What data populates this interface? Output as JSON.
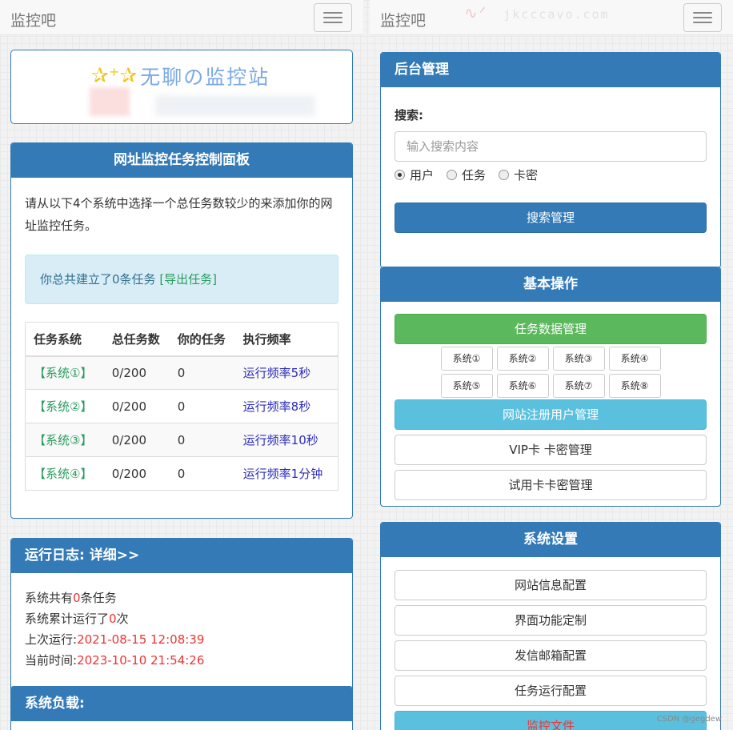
{
  "left": {
    "brand": "监控吧",
    "logo_text": "无聊の监控站",
    "task_panel": {
      "title": "网址监控任务控制面板",
      "intro": "请从以下4个系统中选择一个总任务数较少的来添加你的网址监控任务。",
      "alert_text": "你总共建立了0条任务 ",
      "alert_link": "[导出任务]",
      "columns": [
        "任务系统",
        "总任务数",
        "你的任务",
        "执行频率"
      ],
      "rows": [
        {
          "system": "【系统①】",
          "total": "0/200",
          "mine": "0",
          "freq": "运行频率5秒"
        },
        {
          "system": "【系统②】",
          "total": "0/200",
          "mine": "0",
          "freq": "运行频率8秒"
        },
        {
          "system": "【系统③】",
          "total": "0/200",
          "mine": "0",
          "freq": "运行频率10秒"
        },
        {
          "system": "【系统④】",
          "total": "0/200",
          "mine": "0",
          "freq": "运行频率1分钟"
        }
      ]
    },
    "log_panel": {
      "title": "运行日志:  详细>>",
      "line1_prefix": "系统共有",
      "line1_value": "0",
      "line1_suffix": "条任务",
      "line2_prefix": "系统累计运行了",
      "line2_value": "0",
      "line2_suffix": "次",
      "line3_prefix": "上次运行:",
      "line3_value": "2021-08-15 12:08:39",
      "line4_prefix": "当前时间:",
      "line4_value": "2023-10-10 21:54:26"
    },
    "load_panel": {
      "title": "系统负载:"
    }
  },
  "right": {
    "brand": "监控吧",
    "watermark": "jkcccavo.com",
    "admin_panel": {
      "title": "后台管理",
      "search_label": "搜索:",
      "search_placeholder": "输入搜索内容",
      "radio_options": [
        "用户",
        "任务",
        "卡密"
      ],
      "selected": "用户",
      "search_button": "搜索管理"
    },
    "basic_panel": {
      "title": "基本操作",
      "task_data_button": "任务数据管理",
      "systems": [
        "系统①",
        "系统②",
        "系统③",
        "系统④",
        "系统⑤",
        "系统⑥",
        "系统⑦",
        "系统⑧"
      ],
      "user_button": "网站注册用户管理",
      "vip_button": "VIP卡 卡密管理",
      "trial_button": "试用卡卡密管理"
    },
    "settings_panel": {
      "title": "系统设置",
      "buttons": [
        "网站信息配置",
        "界面功能定制",
        "发信邮箱配置",
        "任务运行配置"
      ],
      "file_button": "监控文件"
    }
  },
  "watermark_csdn": "CSDN @gegdew",
  "colors": {
    "primary": "#337ab7",
    "success": "#5cb85c",
    "info": "#5bc0de",
    "red_text": "#e33333",
    "link_green": "#2a9b5e",
    "link_blue": "#2c2cb8"
  }
}
